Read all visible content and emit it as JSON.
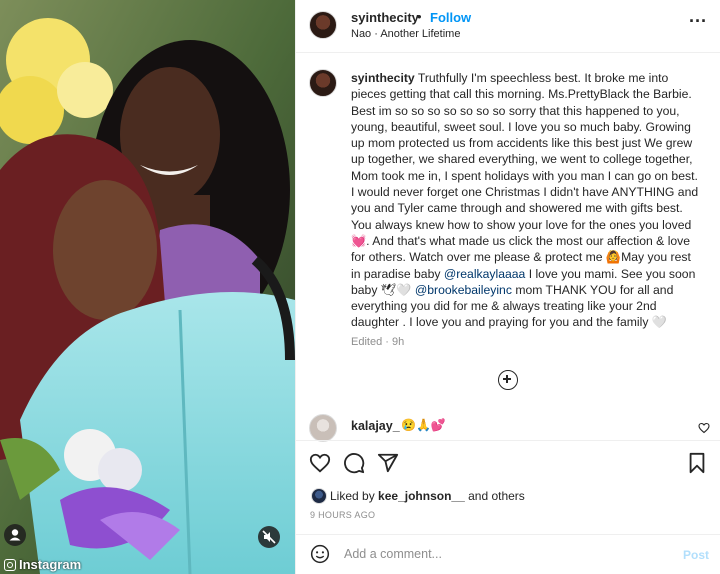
{
  "photo": {
    "credit_label": "Instagram"
  },
  "header": {
    "username": "syinthecity",
    "separator": "•",
    "follow_label": "Follow",
    "audio": "Nao · Another Lifetime",
    "more_label": "···"
  },
  "caption": {
    "username": "syinthecity",
    "text_part1": "Truthfully I'm speechless best. It broke me into pieces getting that call this morning. Ms.PrettyBlack the Barbie. Best im so so so so so so so sorry that this happened to you, young, beautiful, sweet soul. I love you so much baby. Growing up mom protected us from accidents like this best just We grew up together, we shared everything, we went to college together, Mom took me in, I spent holidays with you man I can go on best. I would never forget one Christmas I didn't have ANYTHING and you and Tyler came through and showered me with gifts best. You always knew how to show your love for the ones you loved 💓. And that's what made us click the most our affection & love for others. Watch over me please & protect me 🙆May you rest in paradise baby",
    "mention1": "@realkaylaaaa",
    "text_part2": "I love you mami. See you soon baby 🕊🤍",
    "mention2": "@brookebaileyinc",
    "text_part3": "mom THANK YOU for all and everything you did for me & always treating like your 2nd daughter . I love you and praying for you and the family 🤍",
    "edited": "Edited · 9h"
  },
  "comment": {
    "username": "kalajay_",
    "text": "😢🙏💕"
  },
  "likes": {
    "prefix": "Liked by",
    "user": "kee_johnson__",
    "suffix": "and others"
  },
  "timestamp": "9 HOURS AGO",
  "add_comment": {
    "placeholder": "Add a comment...",
    "post_label": "Post"
  }
}
